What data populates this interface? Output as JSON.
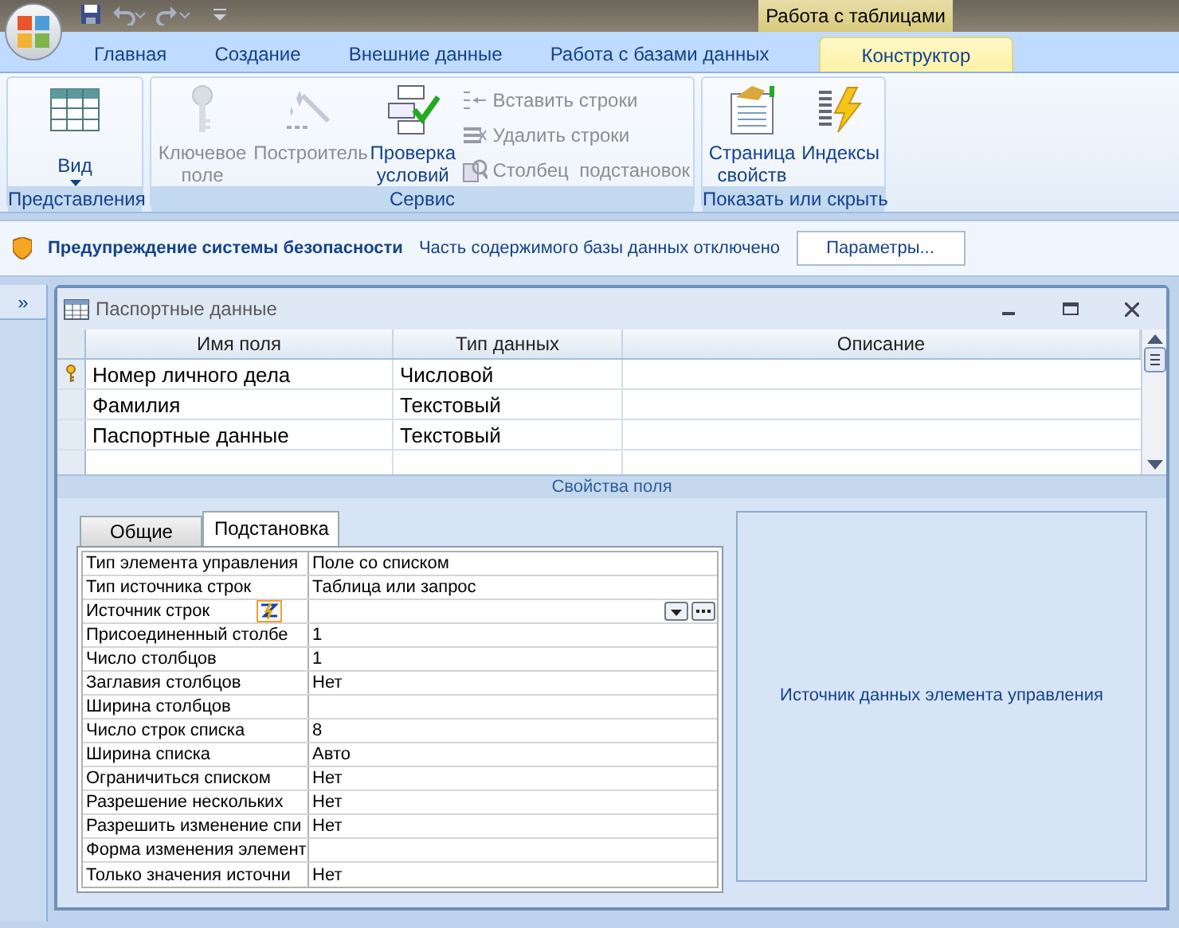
{
  "quick_access": {
    "contextual_title": "Работа с таблицами"
  },
  "tabs": [
    {
      "label": "Главная",
      "selected": false
    },
    {
      "label": "Создание",
      "selected": false
    },
    {
      "label": "Внешние данные",
      "selected": false
    },
    {
      "label": "Работа с базами данных",
      "selected": false
    },
    {
      "label": "Конструктор",
      "selected": true
    }
  ],
  "ribbon_groups": [
    {
      "label": "Представления",
      "items": [
        {
          "kind": "large",
          "label": "Вид",
          "disabled": false,
          "dropdown": true
        }
      ]
    },
    {
      "label": "Сервис",
      "items": [
        {
          "kind": "large",
          "label": "Ключевое поле",
          "disabled": true
        },
        {
          "kind": "large",
          "label": "Построитель",
          "disabled": true
        },
        {
          "kind": "large",
          "label": "Проверка условий",
          "disabled": false
        },
        {
          "kind": "stack",
          "rows": [
            {
              "label": "Вставить строки",
              "disabled": true
            },
            {
              "label": "Удалить строки",
              "disabled": true
            },
            {
              "label": "Столбец  подстановок",
              "disabled": true
            }
          ]
        }
      ]
    },
    {
      "label": "Показать или скрыть",
      "items": [
        {
          "kind": "large",
          "label": "Страница свойств",
          "disabled": false
        },
        {
          "kind": "large",
          "label": "Индексы",
          "disabled": false
        }
      ]
    }
  ],
  "security_bar": {
    "title": "Предупреждение системы безопасности",
    "message": "Часть содержимого базы данных отключено",
    "button": "Параметры..."
  },
  "nav_pane": {
    "toggle": "»"
  },
  "document": {
    "title": "Паспортные данные",
    "columns": [
      "Имя поля",
      "Тип данных",
      "Описание"
    ],
    "rows": [
      {
        "name": "Номер личного дела",
        "type": "Числовой",
        "primary_key": true
      },
      {
        "name": "Фамилия",
        "type": "Текстовый",
        "primary_key": false
      },
      {
        "name": "Паспортные данные",
        "type": "Текстовый",
        "primary_key": false
      }
    ],
    "section_title": "Свойства поля",
    "property_tabs": [
      {
        "label": "Общие",
        "selected": false
      },
      {
        "label": "Подстановка",
        "selected": true
      }
    ],
    "properties": [
      {
        "label": "Тип элемента управления",
        "value": "Поле со списком"
      },
      {
        "label": "Тип источника строк",
        "value": "Таблица или запрос"
      },
      {
        "label": "Источник строк",
        "active": true
      },
      {
        "label": "Присоединенный столбе",
        "value": "1"
      },
      {
        "label": "Число столбцов",
        "value": "1"
      },
      {
        "label": "Заглавия столбцов",
        "value": "Нет"
      },
      {
        "label": "Ширина столбцов"
      },
      {
        "label": "Число строк списка",
        "value": "8"
      },
      {
        "label": "Ширина списка",
        "value": "Авто"
      },
      {
        "label": "Ограничиться списком",
        "value": "Нет"
      },
      {
        "label": "Разрешение нескольких",
        "value": "Нет"
      },
      {
        "label": "Разрешить изменение спи",
        "value": "Нет"
      },
      {
        "label": "Форма изменения элемент"
      },
      {
        "label": "Только значения источни",
        "value": "Нет"
      }
    ],
    "help_text": "Источник данных элемента управления"
  }
}
